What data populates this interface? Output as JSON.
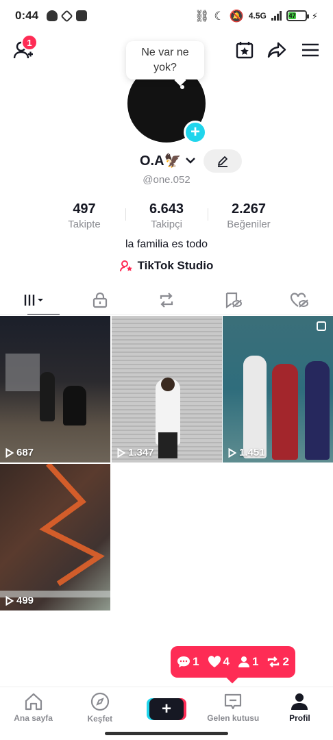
{
  "status_bar": {
    "time": "0:44",
    "network": "4.5G",
    "battery": "47"
  },
  "header": {
    "friend_badge": "1"
  },
  "profile": {
    "bubble_text": "Ne var ne yok?",
    "name": "O.A🦅",
    "handle": "@one.052",
    "bio": "la familia es todo",
    "studio_label": "TikTok Studio"
  },
  "stats": [
    {
      "value": "497",
      "label": "Takipte"
    },
    {
      "value": "6.643",
      "label": "Takipçi"
    },
    {
      "value": "2.267",
      "label": "Beğeniler"
    }
  ],
  "tabs": [
    "videos-icon",
    "lock-icon",
    "repost-icon",
    "favorites-icon",
    "liked-icon"
  ],
  "videos": [
    {
      "views": "687"
    },
    {
      "views": "1.347"
    },
    {
      "views": "1.451"
    },
    {
      "views": "499"
    }
  ],
  "notification": {
    "comments": "1",
    "likes": "4",
    "followers": "1",
    "reposts": "2"
  },
  "bottom_nav": {
    "home": "Ana sayfa",
    "discover": "Keşfet",
    "inbox": "Gelen kutusu",
    "profile": "Profil",
    "create": "+"
  },
  "colors": {
    "accent": "#fe2c55",
    "cyan": "#20d5ec",
    "text": "#161823",
    "muted": "#8a8b91"
  }
}
